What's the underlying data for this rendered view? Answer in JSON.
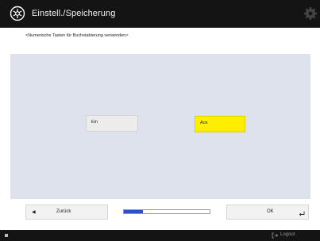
{
  "header": {
    "title": "Einstell./Speicherung",
    "icon": "settings-register-icon",
    "gear_icon": "gear-icon"
  },
  "instruction": "<Numerische Tasten für Buchstabierung verwenden>",
  "options": {
    "ein_label": "Ein",
    "aus_label": "Aus",
    "selected": "Aus",
    "selected_color": "#ffee00"
  },
  "footer": {
    "back_label": "Zurück",
    "ok_label": "OK",
    "progress_fraction": 0.22,
    "progress_color": "#2b53c8"
  },
  "statusbar": {
    "logout_label": "Logout"
  }
}
